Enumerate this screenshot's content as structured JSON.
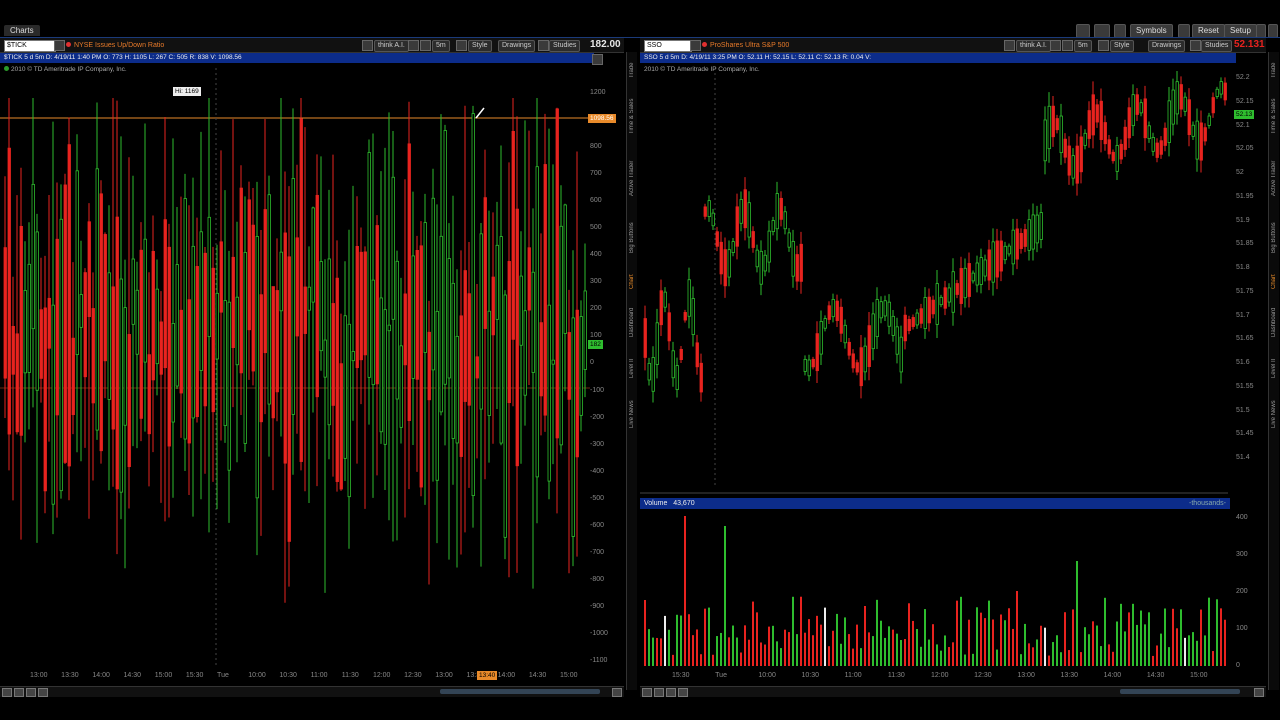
{
  "app": {
    "tab": "Charts",
    "top_buttons": [
      "Symbols",
      "Reset",
      "Setup"
    ]
  },
  "left": {
    "symbol": "$TICK",
    "description": "NYSE Issues Up/Down Ratio",
    "toolbar": {
      "think": "think A.I.",
      "period": "5m",
      "style": "Style",
      "drawings": "Drawings",
      "studies": "Studies"
    },
    "last": "182.00",
    "ohlc": "$TICK 5 d 5m   D: 4/19/11 1:40 PM   O: 773   H: 1105   L: 267   C: 505   R: 838   V: 1098.56",
    "copyright": "2010 © TD Ameritrade IP Company, Inc.",
    "hi_tag": "Hi: 1169",
    "price_tag": "1098.56",
    "cur_tag": "182",
    "time_tag": "13:40",
    "yticks": [
      "1200",
      "1000",
      "800",
      "700",
      "600",
      "500",
      "400",
      "300",
      "200",
      "100",
      "0",
      "-100",
      "-200",
      "-300",
      "-400",
      "-500",
      "-600",
      "-700",
      "-800",
      "-900",
      "-1000",
      "-1100"
    ],
    "xticks": [
      "13:00",
      "13:30",
      "14:00",
      "14:30",
      "15:00",
      "15:30",
      "Tue",
      "10:00",
      "10:30",
      "11:00",
      "11:30",
      "12:00",
      "12:30",
      "13:00",
      "13:30",
      "14:00",
      "14:30",
      "15:00"
    ],
    "side_tabs": [
      "Trade",
      "Time & Sales",
      "Active Trader",
      "Big Buttons",
      "Chart",
      "Dashboard",
      "Level II",
      "Live News"
    ]
  },
  "right": {
    "symbol": "SSO",
    "description": "ProShares Ultra S&P 500",
    "toolbar": {
      "think": "think A.I.",
      "period": "5m",
      "style": "Style",
      "drawings": "Drawings",
      "studies": "Studies"
    },
    "last": "52.131",
    "ohlc": "SSO 5 d 5m   D: 4/19/11 3:25 PM   O: 52.11   H: 52.15   L: 52.11   C: 52.13   R: 0.04   V:",
    "copyright": "2010 © TD Ameritrade IP Company, Inc.",
    "cur_tag": "52.13",
    "yticks": [
      "52.2",
      "52.15",
      "52.1",
      "52.05",
      "52",
      "51.95",
      "51.9",
      "51.85",
      "51.8",
      "51.75",
      "51.7",
      "51.65",
      "51.6",
      "51.55",
      "51.5",
      "51.45",
      "51.4"
    ],
    "xticks": [
      "15:30",
      "Tue",
      "10:00",
      "10:30",
      "11:00",
      "11:30",
      "12:00",
      "12:30",
      "13:00",
      "13:30",
      "14:00",
      "14:30",
      "15:00"
    ],
    "volume": {
      "label": "Volume",
      "value": "43,670",
      "unit": "-thousands-",
      "yticks": [
        "400",
        "300",
        "200",
        "100",
        "0"
      ]
    },
    "side_tabs": [
      "Trade",
      "Time & Sales",
      "Active Trader",
      "Big Buttons",
      "Chart",
      "Dashboard",
      "Level II",
      "Live News"
    ]
  },
  "colors": {
    "up": "#2ebd2e",
    "down": "#e8231f",
    "orange": "#e88a2a",
    "blue": "#0c2c8a"
  }
}
